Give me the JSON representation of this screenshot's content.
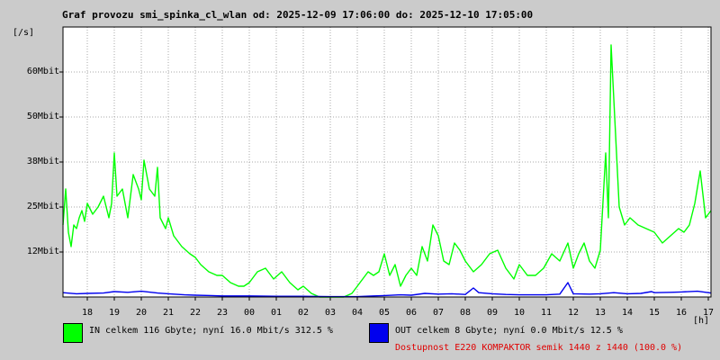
{
  "title": "Graf provozu smi_spinka_cl_wlan od: 2025-12-09 17:06:00 do: 2025-12-10 17:05:00",
  "legend": {
    "in_text": "IN celkem 116 Gbyte; nyní  16.0 Mbit/s 312.5 %",
    "out_text": "OUT celkem 8 Gbyte; nyní   0.0 Mbit/s 12.5 %",
    "availability": "Dostupnost E220 KOMPAKTOR semik 1440 z 1440 (100.0 %)"
  },
  "colors": {
    "in": "#00ff00",
    "out": "#0000ee",
    "grid": "#a8a8a8",
    "availability": "#e00000",
    "background": "#ffffff"
  },
  "chart_data": {
    "type": "line",
    "title": "Graf provozu smi_spinka_cl_wlan od: 2025-12-09 17:06:00 do: 2025-12-10 17:05:00",
    "ylabel": "[/s]",
    "xlabel": "[h]",
    "y_unit": "Mbit",
    "ylim": [
      0,
      75
    ],
    "xlim": [
      17.1,
      41.1
    ],
    "grid": true,
    "legend_placement": "bottom",
    "ytick_values": [
      12.5,
      25,
      37.5,
      50,
      62.5
    ],
    "ytick_labels": [
      "12Mbit",
      "25Mbit",
      "38Mbit",
      "50Mbit",
      "60Mbit"
    ],
    "xtick_values": [
      18,
      19,
      20,
      21,
      22,
      23,
      24,
      25,
      26,
      27,
      28,
      29,
      30,
      31,
      32,
      33,
      34,
      35,
      36,
      37,
      38,
      39,
      40,
      41
    ],
    "xtick_labels": [
      "18",
      "19",
      "20",
      "21",
      "22",
      "23",
      "00",
      "01",
      "02",
      "03",
      "04",
      "05",
      "06",
      "07",
      "08",
      "09",
      "10",
      "11",
      "12",
      "13",
      "14",
      "15",
      "16",
      "17"
    ],
    "series": [
      {
        "name": "IN",
        "x": [
          17.1,
          17.2,
          17.3,
          17.4,
          17.5,
          17.6,
          17.7,
          17.8,
          17.9,
          18.0,
          18.2,
          18.4,
          18.6,
          18.8,
          18.9,
          19.0,
          19.1,
          19.3,
          19.5,
          19.7,
          19.9,
          20.0,
          20.1,
          20.3,
          20.5,
          20.6,
          20.7,
          20.9,
          21.0,
          21.2,
          21.5,
          21.8,
          22.0,
          22.2,
          22.5,
          22.8,
          23.0,
          23.3,
          23.6,
          23.8,
          24.0,
          24.3,
          24.6,
          24.9,
          25.2,
          25.5,
          25.8,
          26.0,
          26.3,
          26.6,
          26.9,
          27.2,
          27.5,
          27.8,
          28.0,
          28.2,
          28.4,
          28.6,
          28.8,
          29.0,
          29.2,
          29.4,
          29.6,
          29.8,
          30.0,
          30.2,
          30.4,
          30.6,
          30.8,
          31.0,
          31.2,
          31.4,
          31.6,
          31.8,
          32.0,
          32.3,
          32.6,
          32.9,
          33.2,
          33.5,
          33.8,
          34.0,
          34.3,
          34.6,
          34.9,
          35.2,
          35.5,
          35.8,
          36.0,
          36.2,
          36.4,
          36.6,
          36.8,
          37.0,
          37.2,
          37.3,
          37.4,
          37.5,
          37.7,
          37.9,
          38.1,
          38.4,
          38.7,
          39.0,
          39.3,
          39.6,
          39.9,
          40.1,
          40.3,
          40.5,
          40.7,
          40.9,
          41.1
        ],
        "values": [
          20,
          30,
          18,
          14,
          20,
          19,
          22,
          24,
          21,
          26,
          23,
          25,
          28,
          22,
          26,
          40,
          28,
          30,
          22,
          34,
          30,
          27,
          38,
          30,
          28,
          36,
          22,
          19,
          22,
          17,
          14,
          12,
          11,
          9,
          7,
          6,
          6,
          4,
          3,
          3,
          4,
          7,
          8,
          5,
          7,
          4,
          2,
          3,
          1,
          0,
          0,
          0,
          0,
          1,
          3,
          5,
          7,
          6,
          7,
          12,
          6,
          9,
          3,
          6,
          8,
          6,
          14,
          10,
          20,
          17,
          10,
          9,
          15,
          13,
          10,
          7,
          9,
          12,
          13,
          8,
          5,
          9,
          6,
          6,
          8,
          12,
          10,
          15,
          8,
          12,
          15,
          10,
          8,
          13,
          40,
          22,
          70,
          55,
          25,
          20,
          22,
          20,
          19,
          18,
          15,
          17,
          19,
          18,
          20,
          26,
          35,
          22,
          24
        ]
      },
      {
        "name": "OUT",
        "x": [
          17.1,
          17.6,
          18.0,
          18.6,
          19.0,
          19.5,
          20.0,
          20.6,
          21.0,
          21.6,
          22.0,
          22.6,
          23.0,
          23.6,
          24.0,
          25.0,
          26.0,
          27.0,
          28.0,
          28.6,
          29.0,
          29.6,
          30.0,
          30.5,
          31.0,
          31.5,
          32.0,
          32.3,
          32.5,
          33.0,
          33.5,
          34.0,
          35.0,
          35.5,
          35.8,
          36.0,
          36.6,
          37.0,
          37.5,
          38.0,
          38.5,
          38.9,
          39.0,
          39.6,
          40.0,
          40.6,
          41.1
        ],
        "values": [
          1.2,
          0.9,
          1.0,
          1.1,
          1.5,
          1.3,
          1.6,
          1.1,
          0.9,
          0.6,
          0.5,
          0.4,
          0.3,
          0.3,
          0.3,
          0.2,
          0.2,
          0.1,
          0.1,
          0.3,
          0.4,
          0.6,
          0.5,
          1.0,
          0.8,
          0.9,
          0.7,
          2.5,
          1.2,
          0.9,
          0.7,
          0.6,
          0.6,
          0.8,
          4.0,
          0.9,
          0.8,
          0.9,
          1.2,
          0.9,
          1.0,
          1.5,
          1.2,
          1.3,
          1.4,
          1.6,
          1.1
        ]
      }
    ]
  }
}
